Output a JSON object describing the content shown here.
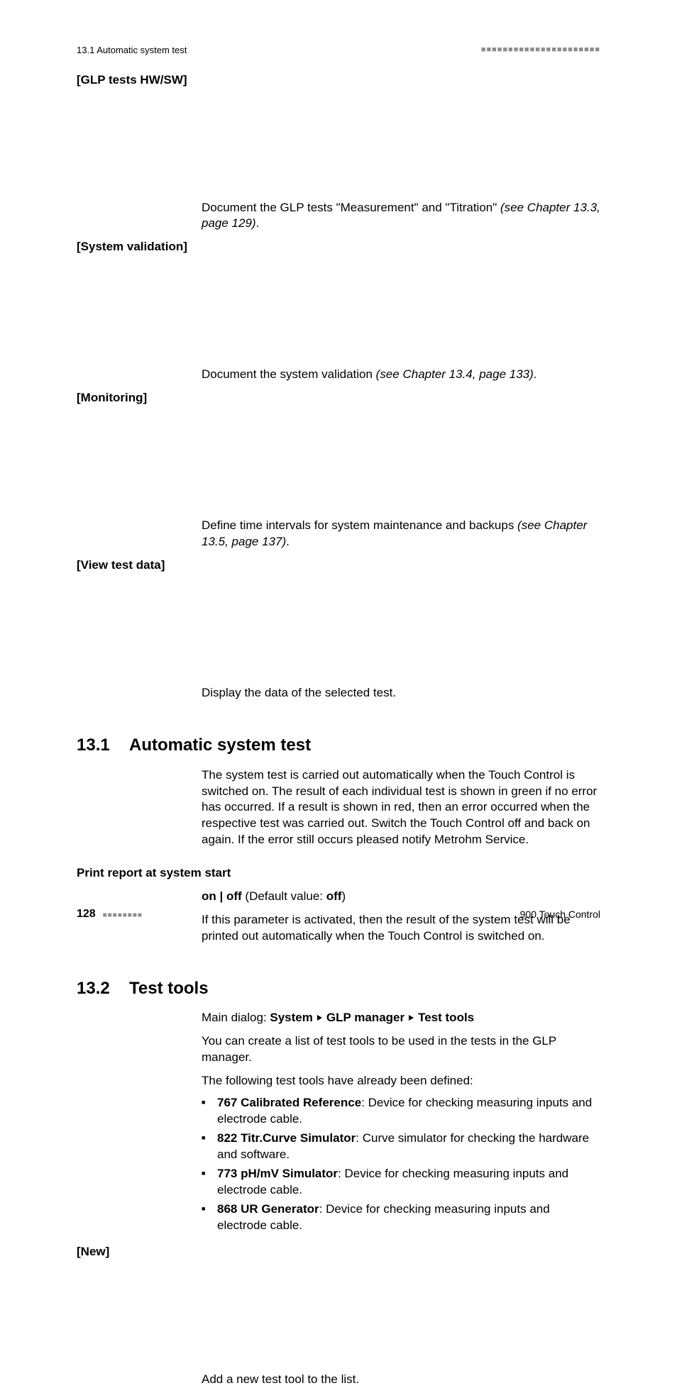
{
  "running_head": {
    "left": "13.1 Automatic system test",
    "squares": "■■■■■■■■■■■■■■■■■■■■■■"
  },
  "defs": [
    {
      "term": "[GLP tests HW/SW]",
      "desc_pre": "Document the GLP tests \"Measurement\" and \"Titration\" ",
      "desc_ital": "(see Chapter 13.3, page 129)",
      "desc_post": "."
    },
    {
      "term": "[System validation]",
      "desc_pre": "Document the system validation ",
      "desc_ital": "(see Chapter 13.4, page 133)",
      "desc_post": "."
    },
    {
      "term": "[Monitoring]",
      "desc_pre": "Define time intervals for system maintenance and backups ",
      "desc_ital": "(see Chapter 13.5, page 137)",
      "desc_post": "."
    },
    {
      "term": "[View test data]",
      "desc_pre": "Display the data of the selected test.",
      "desc_ital": "",
      "desc_post": ""
    }
  ],
  "s131": {
    "num": "13.1",
    "title": "Automatic system test",
    "para": "The system test is carried out automatically when the Touch Control is switched on. The result of each individual test is shown in green if no error has occurred. If a result is shown in red, then an error occurred when the respective test was carried out. Switch the Touch Control off and back on again. If the error still occurs pleased notify Metrohm Service.",
    "subhead": "Print report at system start",
    "opt_bold1": "on | off",
    "opt_plain": " (Default value: ",
    "opt_bold2": "off",
    "opt_close": ")",
    "para2": "If this parameter is activated, then the result of the system test will be printed out automatically when the Touch Control is switched on."
  },
  "s132": {
    "num": "13.2",
    "title": "Test tools",
    "nav_pre": "Main dialog: ",
    "nav_a": "System",
    "nav_b": "GLP manager",
    "nav_c": "Test tools",
    "p1": "You can create a list of test tools to be used in the tests in the GLP manager.",
    "p2": "The following test tools have already been defined:",
    "items": [
      {
        "b": "767 Calibrated Reference",
        "rest": ": Device for checking measuring inputs and electrode cable."
      },
      {
        "b": "822 Titr.Curve Simulator",
        "rest": ": Curve simulator for checking the hardware and software."
      },
      {
        "b": "773 pH/mV Simulator",
        "rest": ": Device for checking measuring inputs and electrode cable."
      },
      {
        "b": "868 UR Generator",
        "rest": ": Device for checking measuring inputs and electrode cable."
      }
    ],
    "new_term": "[New]",
    "new_desc": "Add a new test tool to the list."
  },
  "footer": {
    "page": "128",
    "squares": "■■■■■■■■",
    "product": "900 Touch Control"
  }
}
